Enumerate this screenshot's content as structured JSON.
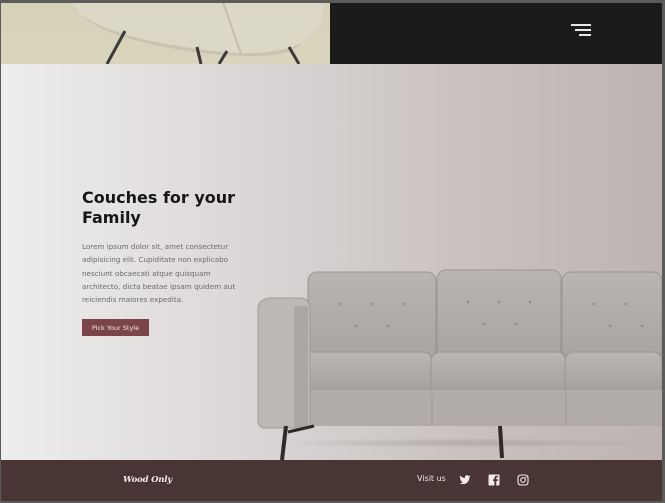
{
  "header": {
    "menu_icon": "hamburger-menu-icon"
  },
  "hero": {
    "title": "Couches for your Family",
    "body": "Lorem ipsum dolor sit, amet consectetur adipisicing elit. Cupiditate non explicabo nesciunt obcaecati atque quisquam architecto, dicta beatae ipsam quidem aut reiciendis maiores expedita.",
    "cta_label": "Pick Your Style"
  },
  "footer": {
    "brand": "Wood Only",
    "visit_label": "Visit us",
    "social": [
      "twitter-icon",
      "facebook-icon",
      "instagram-icon"
    ]
  },
  "colors": {
    "header_dark": "#1b1b1b",
    "cta": "#7b4448",
    "footer": "#4a3535"
  }
}
